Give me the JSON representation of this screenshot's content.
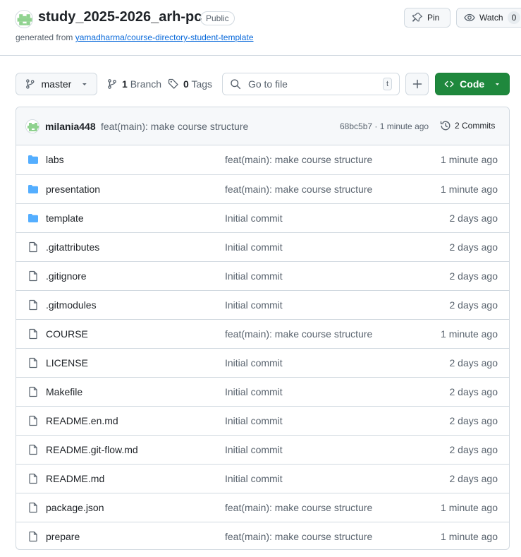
{
  "header": {
    "repo_name": "study_2025-2026_arh-pc",
    "visibility": "Public",
    "generated_prefix": "generated from ",
    "template_link": "yamadharma/course-directory-student-template",
    "pin_label": "Pin",
    "watch_label": "Watch",
    "watch_count": "0"
  },
  "toolbar": {
    "branch": "master",
    "branch_count": "1",
    "branch_label": "Branch",
    "tag_count": "0",
    "tag_label": "Tags",
    "search_placeholder": "Go to file",
    "search_shortcut": "t",
    "code_label": "Code"
  },
  "commit": {
    "author": "milania448",
    "message": "feat(main): make course structure",
    "meta": "68bc5b7 · 1 minute ago",
    "commits_label": "2 Commits"
  },
  "colors": {
    "accent_green": "#1f883d",
    "folder_blue": "#54aeff",
    "link_blue": "#0969da"
  },
  "files": [
    {
      "name": "labs",
      "type": "folder",
      "commit": "feat(main): make course structure",
      "age": "1 minute ago"
    },
    {
      "name": "presentation",
      "type": "folder",
      "commit": "feat(main): make course structure",
      "age": "1 minute ago"
    },
    {
      "name": "template",
      "type": "folder",
      "commit": "Initial commit",
      "age": "2 days ago"
    },
    {
      "name": ".gitattributes",
      "type": "file",
      "commit": "Initial commit",
      "age": "2 days ago"
    },
    {
      "name": ".gitignore",
      "type": "file",
      "commit": "Initial commit",
      "age": "2 days ago"
    },
    {
      "name": ".gitmodules",
      "type": "file",
      "commit": "Initial commit",
      "age": "2 days ago"
    },
    {
      "name": "COURSE",
      "type": "file",
      "commit": "feat(main): make course structure",
      "age": "1 minute ago"
    },
    {
      "name": "LICENSE",
      "type": "file",
      "commit": "Initial commit",
      "age": "2 days ago"
    },
    {
      "name": "Makefile",
      "type": "file",
      "commit": "Initial commit",
      "age": "2 days ago"
    },
    {
      "name": "README.en.md",
      "type": "file",
      "commit": "Initial commit",
      "age": "2 days ago"
    },
    {
      "name": "README.git-flow.md",
      "type": "file",
      "commit": "Initial commit",
      "age": "2 days ago"
    },
    {
      "name": "README.md",
      "type": "file",
      "commit": "Initial commit",
      "age": "2 days ago"
    },
    {
      "name": "package.json",
      "type": "file",
      "commit": "feat(main): make course structure",
      "age": "1 minute ago"
    },
    {
      "name": "prepare",
      "type": "file",
      "commit": "feat(main): make course structure",
      "age": "1 minute ago"
    }
  ]
}
